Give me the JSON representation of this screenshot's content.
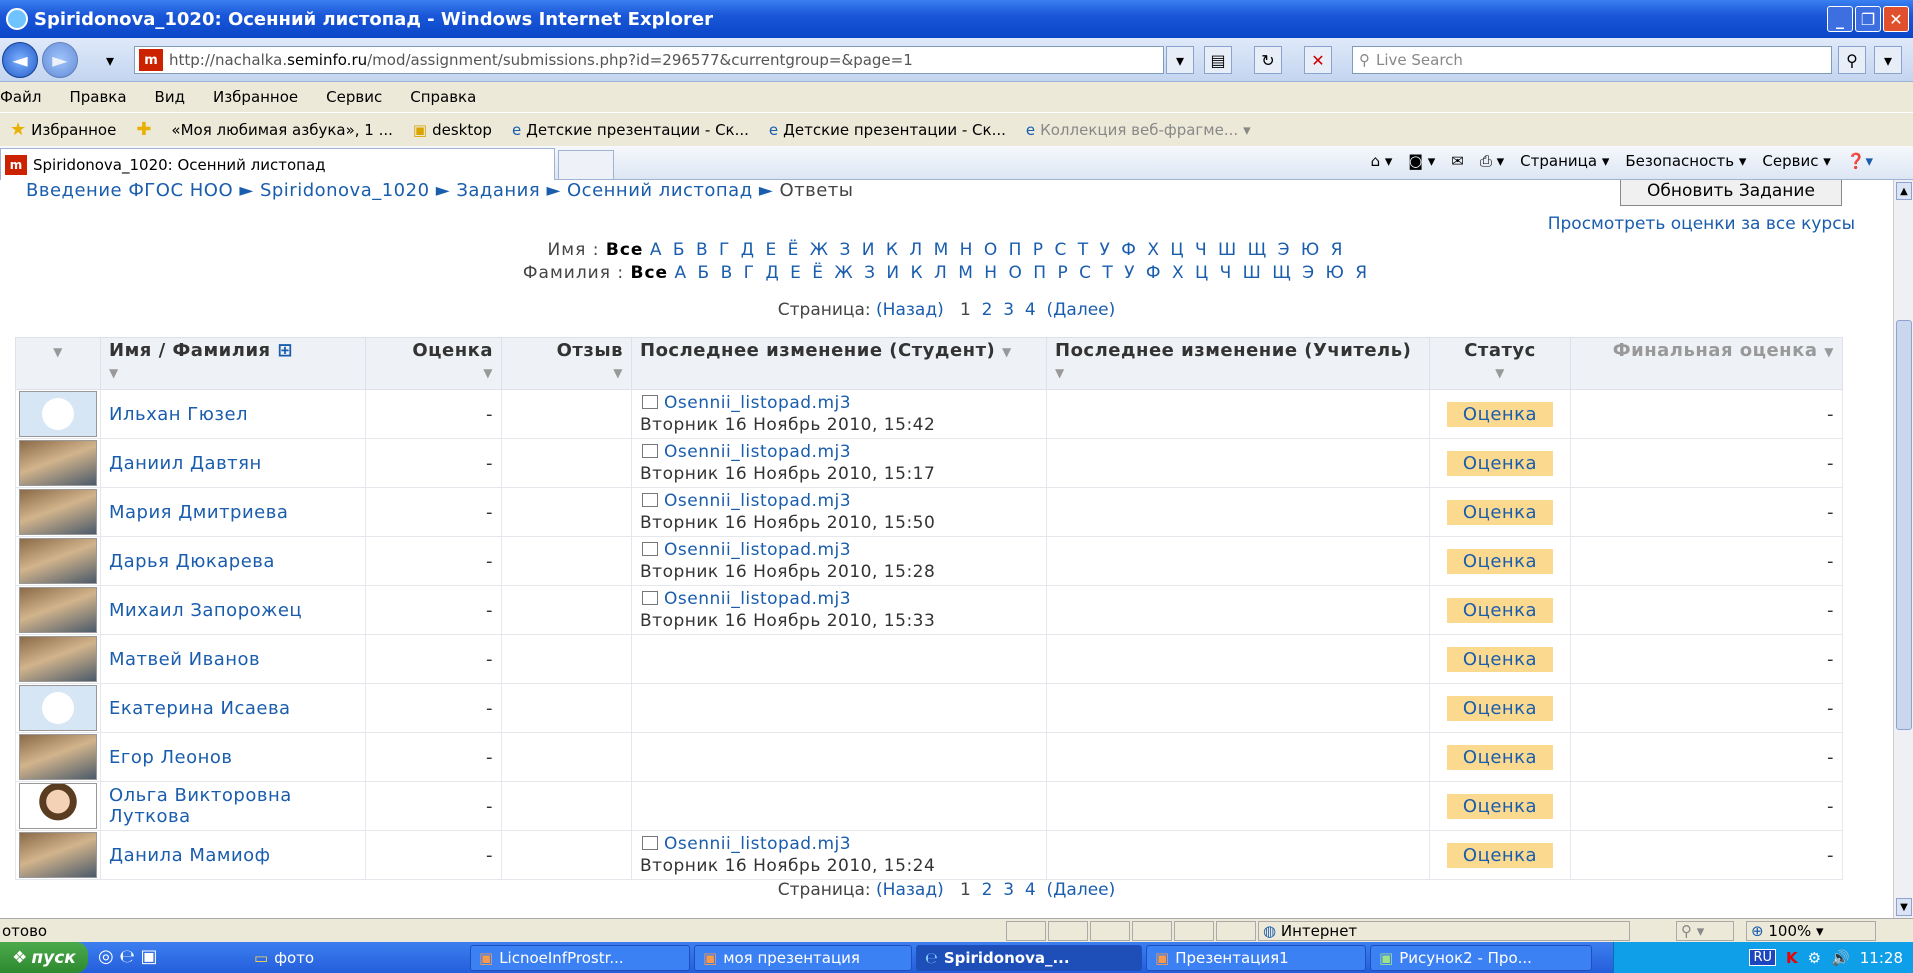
{
  "window": {
    "title": "Spiridonova_1020: Осенний листопад - Windows Internet Explorer"
  },
  "address": {
    "url_prefix": "http://nachalka.",
    "url_domain": "seminfo.ru",
    "url_path": "/mod/assignment/submissions.php?id=296577&currentgroup=&page=1",
    "search_placeholder": "Live Search"
  },
  "menu": [
    "Файл",
    "Правка",
    "Вид",
    "Избранное",
    "Сервис",
    "Справка"
  ],
  "favorites": {
    "label": "Избранное",
    "items": [
      "«Моя любимая азбука», 1 ...",
      "desktop",
      "Детские презентации - Ск...",
      "Детские презентации - Ск...",
      "Коллекция веб-фрагме..."
    ]
  },
  "tab": {
    "title": "Spiridonova_1020: Осенний листопад"
  },
  "commandbar": [
    "Страница",
    "Безопасность",
    "Сервис"
  ],
  "page": {
    "breadcrumb": {
      "items": [
        "Введение ФГОС НОО",
        "Spiridonova_1020",
        "Задания",
        "Осенний листопад"
      ],
      "current": "Ответы",
      "sep": "►"
    },
    "update_button": "Обновить Задание",
    "all_grades_link": "Просмотреть оценки за все курсы",
    "firstname_filter": {
      "label": "Имя",
      "all": "Все",
      "letters": "А Б В Г Д Е Ё Ж З И К Л М Н О П Р С Т У Ф Х Ц Ч Ш Щ Э Ю Я"
    },
    "lastname_filter": {
      "label": "Фамилия",
      "all": "Все",
      "letters": "А Б В Г Д Е Ё Ж З И К Л М Н О П Р С Т У Ф Х Ц Ч Ш Щ Э Ю Я"
    },
    "pager": {
      "label": "Страница:",
      "prev": "(Назад)",
      "pages": [
        "1",
        "2",
        "3",
        "4"
      ],
      "next": "(Далее)"
    }
  },
  "table": {
    "headers": {
      "name": "Имя / Фамилия",
      "grade": "Оценка",
      "feedback": "Отзыв",
      "student_modified": "Последнее изменение (Студент)",
      "teacher_modified": "Последнее изменение (Учитель)",
      "status": "Статус",
      "final": "Финальная оценка"
    },
    "rows": [
      {
        "name": "Ильхан Гюзел",
        "avatar": "blank",
        "grade": "-",
        "file": "Osennii_listopad.mj3",
        "date": "Вторник 16 Ноябрь 2010, 15:42",
        "status": "Оценка",
        "final": "-"
      },
      {
        "name": "Даниил Давтян",
        "avatar": "photo",
        "grade": "-",
        "file": "Osennii_listopad.mj3",
        "date": "Вторник 16 Ноябрь 2010, 15:17",
        "status": "Оценка",
        "final": "-"
      },
      {
        "name": "Мария Дмитриева",
        "avatar": "photo",
        "grade": "-",
        "file": "Osennii_listopad.mj3",
        "date": "Вторник 16 Ноябрь 2010, 15:50",
        "status": "Оценка",
        "final": "-"
      },
      {
        "name": "Дарья Дюкарева",
        "avatar": "photo",
        "grade": "-",
        "file": "Osennii_listopad.mj3",
        "date": "Вторник 16 Ноябрь 2010, 15:28",
        "status": "Оценка",
        "final": "-"
      },
      {
        "name": "Михаил Запорожец",
        "avatar": "photo",
        "grade": "-",
        "file": "Osennii_listopad.mj3",
        "date": "Вторник 16 Ноябрь 2010, 15:33",
        "status": "Оценка",
        "final": "-"
      },
      {
        "name": "Матвей Иванов",
        "avatar": "photo",
        "grade": "-",
        "file": "",
        "date": "",
        "status": "Оценка",
        "final": "-"
      },
      {
        "name": "Екатерина Исаева",
        "avatar": "blank",
        "grade": "-",
        "file": "",
        "date": "",
        "status": "Оценка",
        "final": "-"
      },
      {
        "name": "Егор Леонов",
        "avatar": "photo",
        "grade": "-",
        "file": "",
        "date": "",
        "status": "Оценка",
        "final": "-"
      },
      {
        "name": "Ольга Викторовна Луткова",
        "avatar": "portrait",
        "grade": "-",
        "file": "",
        "date": "",
        "status": "Оценка",
        "final": "-"
      },
      {
        "name": "Данила Мамиоф",
        "avatar": "photo",
        "grade": "-",
        "file": "Osennii_listopad.mj3",
        "date": "Вторник 16 Ноябрь 2010, 15:24",
        "status": "Оценка",
        "final": "-"
      }
    ]
  },
  "statusbar": {
    "left": "отово",
    "zone": "Интернет",
    "zoom": "100%"
  },
  "taskbar": {
    "start": "пуск",
    "tasks": [
      "фото",
      "LicnoeInfProstr...",
      "моя презентация",
      "Spiridonova_...",
      "Презентация1",
      "Рисунок2 - Про..."
    ],
    "lang": "RU",
    "clock": "11:28"
  },
  "colors": {
    "link": "#1a5dad",
    "status_bg": "#fbd98f",
    "titlebar": "#0a46c8"
  }
}
